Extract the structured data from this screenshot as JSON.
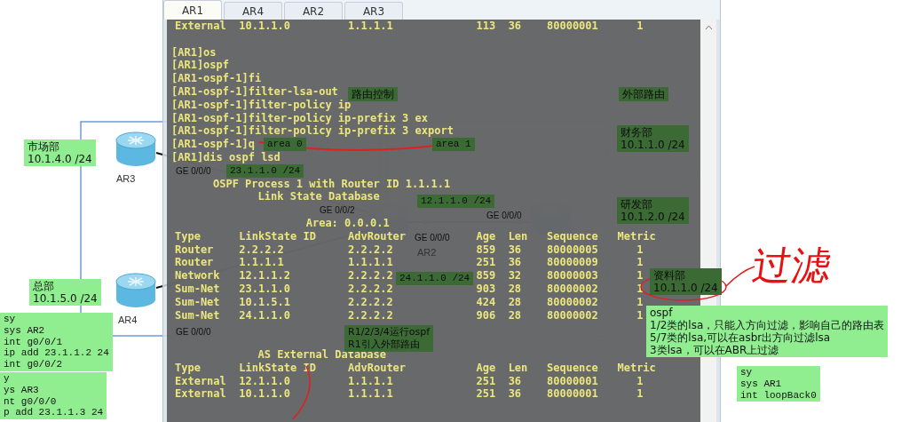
{
  "tabs": [
    {
      "label": "AR1",
      "selected": true
    },
    {
      "label": "AR4",
      "selected": false
    },
    {
      "label": "AR2",
      "selected": false
    },
    {
      "label": "AR3",
      "selected": false
    }
  ],
  "console": {
    "partial_row": [
      "External",
      "10.1.1.0",
      "1.1.1.1",
      "113",
      "36",
      "80000001",
      "1"
    ],
    "commands": [
      "[AR1]os",
      "[AR1]ospf",
      "[AR1-ospf-1]fi",
      "[AR1-ospf-1]filter-lsa-out",
      "[AR1-ospf-1]filter-policy ip",
      "[AR1-ospf-1]filter-policy ip-prefix 3 ex",
      "[AR1-ospf-1]filter-policy ip-prefix 3 export",
      "[AR1-ospf-1]q",
      "[AR1]dis ospf lsd"
    ],
    "lsdb": {
      "heading": "OSPF Process 1 with Router ID 1.1.1.1",
      "subheading": "Link State Database",
      "area": "Area: 0.0.0.1",
      "columns": [
        "Type",
        "LinkState ID",
        "AdvRouter",
        "Age",
        "Len",
        "Sequence",
        "Metric"
      ],
      "rows": [
        [
          "Router",
          "2.2.2.2",
          "2.2.2.2",
          "859",
          "36",
          "80000005",
          "1"
        ],
        [
          "Router",
          "1.1.1.1",
          "1.1.1.1",
          "251",
          "36",
          "80000009",
          "1"
        ],
        [
          "Network",
          "12.1.1.2",
          "2.2.2.2",
          "859",
          "32",
          "80000003",
          "1"
        ],
        [
          "Sum-Net",
          "23.1.1.0",
          "2.2.2.2",
          "903",
          "28",
          "80000002",
          "1"
        ],
        [
          "Sum-Net",
          "10.1.5.1",
          "2.2.2.2",
          "424",
          "28",
          "80000002",
          "1"
        ],
        [
          "Sum-Net",
          "24.1.1.0",
          "2.2.2.2",
          "906",
          "28",
          "80000002",
          "1"
        ]
      ]
    },
    "external": {
      "heading": "AS External Database",
      "columns": [
        "Type",
        "LinkState ID",
        "AdvRouter",
        "Age",
        "Len",
        "Sequence",
        "Metric"
      ],
      "rows": [
        [
          "External",
          "12.1.1.0",
          "1.1.1.1",
          "251",
          "36",
          "80000001",
          "1"
        ],
        [
          "External",
          "10.1.1.0",
          "1.1.1.1",
          "251",
          "36",
          "80000001",
          "1"
        ]
      ]
    }
  },
  "diagram": {
    "router_names": [
      "AR3",
      "AR4",
      "AR2"
    ],
    "interfaces": [
      "GE 0/0/0",
      "GE 0/0/2",
      "GE 0/0/0",
      "GE 0/0/0",
      "GE 0/0/0"
    ],
    "notes": [
      {
        "kind": "dark",
        "lines": [
          "路由控制"
        ]
      },
      {
        "kind": "dark",
        "lines": [
          "外部路由"
        ]
      },
      {
        "kind": "light",
        "lines": [
          "市场部",
          "10.1.4.0 /24"
        ]
      },
      {
        "kind": "dark",
        "lines": [
          "area 0"
        ]
      },
      {
        "kind": "dark",
        "lines": [
          "area 1"
        ]
      },
      {
        "kind": "dark",
        "lines": [
          "财务部",
          "10.1.1.0 /24"
        ]
      },
      {
        "kind": "dark",
        "lines": [
          "23.1.1.0 /24"
        ]
      },
      {
        "kind": "dark",
        "lines": [
          "12.1.1.0 /24"
        ]
      },
      {
        "kind": "dark",
        "lines": [
          "研发部",
          "10.1.2.0 /24"
        ]
      },
      {
        "kind": "light",
        "lines": [
          "总部",
          "10.1.5.0 /24"
        ]
      },
      {
        "kind": "dark",
        "lines": [
          "24.1.1.0 /24"
        ]
      },
      {
        "kind": "dark",
        "lines": [
          "资料部",
          "10.1.1.0 /24"
        ]
      },
      {
        "kind": "light",
        "lines": [
          "sy",
          "sys AR2",
          "int g0/0/1",
          "ip add 23.1.1.2 24",
          "int g0/0/2"
        ]
      },
      {
        "kind": "dark",
        "lines": [
          "R1/2/3/4运行ospf",
          "R1引入外部路由"
        ]
      },
      {
        "kind": "light",
        "lines": [
          "ospf",
          "1/2类的lsa，只能入方向过滤，影响自己的路由表",
          "5/7类的lsa,可以在asbr出方向过滤lsa",
          "3类lsa，可以在ABR上过滤"
        ]
      },
      {
        "kind": "light",
        "lines": [
          "y",
          "ys AR3",
          "nt g0/0/0",
          "p add 23.1.1.3 24"
        ]
      },
      {
        "kind": "light",
        "lines": [
          "sy",
          "sys AR1",
          "int loopBack0"
        ]
      }
    ],
    "handwriting": "过滤"
  }
}
